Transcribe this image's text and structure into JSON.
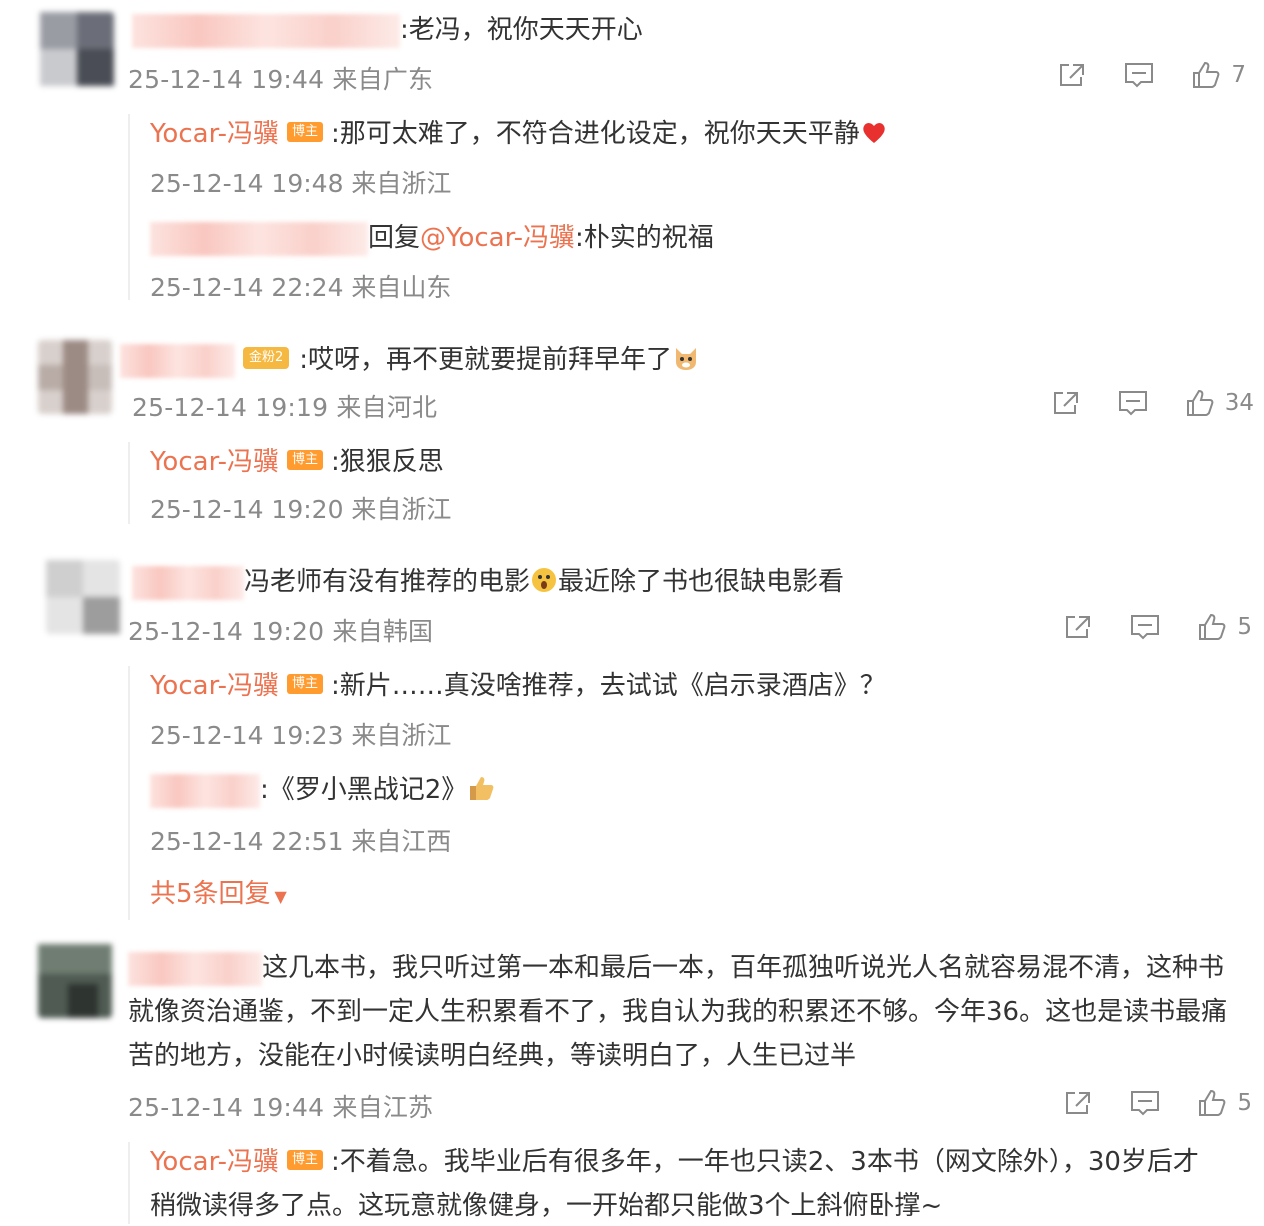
{
  "comments": [
    {
      "text": ":老冯，祝你天天开心",
      "meta": "25-12-14 19:44 来自广东",
      "likes": "7",
      "replies": [
        {
          "author": "Yocar-冯骥",
          "badge": "博主",
          "text": ":那可太难了，不符合进化设定，祝你天天平静",
          "meta": "25-12-14 19:48 来自浙江"
        },
        {
          "prefix": "回复",
          "mention": "@Yocar-冯骥",
          "text": ":朴实的祝福",
          "meta": "25-12-14 22:24 来自山东"
        }
      ]
    },
    {
      "badge": "金粉2",
      "text": ":哎呀，再不更就要提前拜早年了",
      "meta": "25-12-14 19:19 来自河北",
      "likes": "34",
      "replies": [
        {
          "author": "Yocar-冯骥",
          "badge": "博主",
          "text": ":狠狠反思",
          "meta": "25-12-14 19:20 来自浙江"
        }
      ]
    },
    {
      "text_a": "冯老师有没有推荐的电影",
      "text_b": "最近除了书也很缺电影看",
      "meta": "25-12-14 19:20 来自韩国",
      "likes": "5",
      "replies": [
        {
          "author": "Yocar-冯骥",
          "badge": "博主",
          "text": ":新片……真没啥推荐，去试试《启示录酒店》？",
          "meta": "25-12-14 19:23 来自浙江"
        },
        {
          "text": ":《罗小黑战记2》",
          "meta": "25-12-14 22:51 来自江西"
        }
      ],
      "more": "共5条回复"
    },
    {
      "line1": "这几本书，我只听过第一本和最后一本，百年孤独听说光人名就容易混不清，这种书",
      "line2": "就像资治通鉴，不到一定人生积累看不了，我自认为我的积累还不够。今年36。这也是读书最痛",
      "line3": "苦的地方，没能在小时候读明白经典，等读明白了，人生已过半",
      "meta": "25-12-14 19:44 来自江苏",
      "likes": "5",
      "replies": [
        {
          "author": "Yocar-冯骥",
          "badge": "博主",
          "line1": ":不着急。我毕业后有很多年，一年也只读2、3本书（网文除外），30岁后才",
          "line2": "稍微读得多了点。这玩意就像健身，一开始都只能做3个上斜俯卧撑~"
        }
      ]
    }
  ],
  "icons": {
    "share": "share-icon",
    "comment": "comment-icon",
    "like": "thumbs-up-icon"
  },
  "colors": {
    "author": "#eb7350",
    "badge": "#ff9b2f",
    "meta": "#8a8a8a"
  }
}
